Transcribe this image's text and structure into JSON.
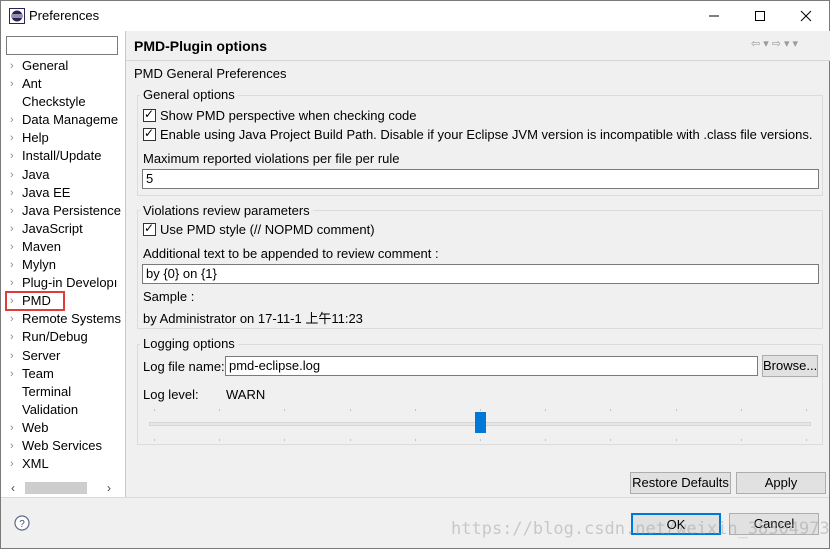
{
  "window": {
    "title": "Preferences"
  },
  "filter": {
    "placeholder": ""
  },
  "tree": [
    {
      "label": "General",
      "expandable": true
    },
    {
      "label": "Ant",
      "expandable": true
    },
    {
      "label": "Checkstyle",
      "expandable": false
    },
    {
      "label": "Data Manageme",
      "expandable": true
    },
    {
      "label": "Help",
      "expandable": true
    },
    {
      "label": "Install/Update",
      "expandable": true
    },
    {
      "label": "Java",
      "expandable": true
    },
    {
      "label": "Java EE",
      "expandable": true
    },
    {
      "label": "Java Persistence",
      "expandable": true
    },
    {
      "label": "JavaScript",
      "expandable": true
    },
    {
      "label": "Maven",
      "expandable": true
    },
    {
      "label": "Mylyn",
      "expandable": true
    },
    {
      "label": "Plug-in Developı",
      "expandable": true
    },
    {
      "label": "PMD",
      "expandable": true,
      "highlighted": true
    },
    {
      "label": "Remote Systems",
      "expandable": true
    },
    {
      "label": "Run/Debug",
      "expandable": true
    },
    {
      "label": "Server",
      "expandable": true
    },
    {
      "label": "Team",
      "expandable": true
    },
    {
      "label": "Terminal",
      "expandable": false
    },
    {
      "label": "Validation",
      "expandable": false
    },
    {
      "label": "Web",
      "expandable": true
    },
    {
      "label": "Web Services",
      "expandable": true
    },
    {
      "label": "XML",
      "expandable": true
    }
  ],
  "page": {
    "title": "PMD-Plugin options",
    "subtitle": "PMD General Preferences"
  },
  "general_options": {
    "title": "General options",
    "show_perspective_label": "Show PMD perspective when checking code",
    "show_perspective_checked": true,
    "build_path_label": "Enable using Java Project Build Path.  Disable if your Eclipse JVM version is incompatible with .class file versions.",
    "build_path_checked": true,
    "max_violations_label": "Maximum reported violations per file per rule",
    "max_violations_value": "5"
  },
  "review": {
    "title": "Violations review parameters",
    "use_pmd_style_label": "Use PMD style (// NOPMD comment)",
    "use_pmd_style_checked": true,
    "additional_text_label": "Additional text to be appended to review comment :",
    "additional_text_value": "by {0} on {1}",
    "sample_label": "Sample :",
    "sample_value": "by Administrator on 17-11-1 上午11:23"
  },
  "logging": {
    "title": "Logging options",
    "file_name_label": "Log file name:",
    "file_name_value": "pmd-eclipse.log",
    "browse_label": "Browse...",
    "log_level_label": "Log level:",
    "log_level_value": "WARN",
    "log_level_position": 0.5
  },
  "buttons": {
    "restore_defaults": "Restore Defaults",
    "apply": "Apply",
    "ok": "OK",
    "cancel": "Cancel"
  },
  "watermark": "https://blog.csdn.net/weixin_38304973",
  "colors": {
    "accent": "#0078d7",
    "highlight_border": "#e23b3b"
  }
}
